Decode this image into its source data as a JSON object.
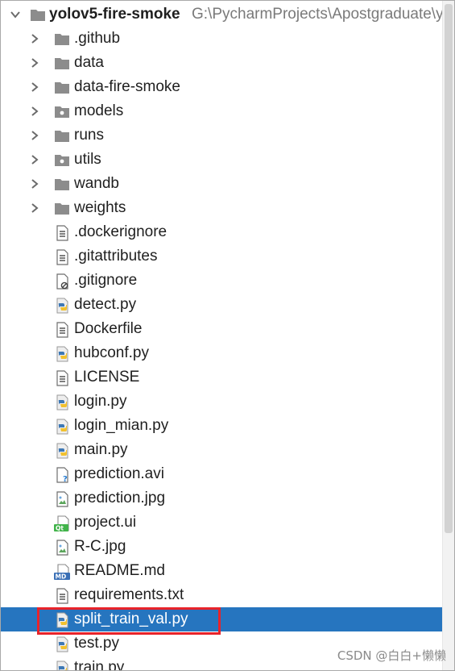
{
  "project": {
    "name": "yolov5-fire-smoke",
    "path": "G:\\PycharmProjects\\Apostgraduate\\yo"
  },
  "items": [
    {
      "label": ".github",
      "kind": "folder",
      "icon": "folder-icon",
      "expandable": true
    },
    {
      "label": "data",
      "kind": "folder",
      "icon": "folder-icon",
      "expandable": true
    },
    {
      "label": "data-fire-smoke",
      "kind": "folder",
      "icon": "folder-icon",
      "expandable": true
    },
    {
      "label": "models",
      "kind": "package",
      "icon": "package-folder-icon",
      "expandable": true
    },
    {
      "label": "runs",
      "kind": "folder",
      "icon": "folder-icon",
      "expandable": true
    },
    {
      "label": "utils",
      "kind": "package",
      "icon": "package-folder-icon",
      "expandable": true
    },
    {
      "label": "wandb",
      "kind": "folder",
      "icon": "folder-icon",
      "expandable": true
    },
    {
      "label": "weights",
      "kind": "folder",
      "icon": "folder-icon",
      "expandable": true
    },
    {
      "label": ".dockerignore",
      "kind": "text",
      "icon": "text-file-icon"
    },
    {
      "label": ".gitattributes",
      "kind": "text",
      "icon": "text-file-icon"
    },
    {
      "label": ".gitignore",
      "kind": "ignore",
      "icon": "ignore-file-icon"
    },
    {
      "label": "detect.py",
      "kind": "python",
      "icon": "python-file-icon"
    },
    {
      "label": "Dockerfile",
      "kind": "text",
      "icon": "text-file-icon"
    },
    {
      "label": "hubconf.py",
      "kind": "python",
      "icon": "python-file-icon"
    },
    {
      "label": "LICENSE",
      "kind": "text",
      "icon": "text-file-icon"
    },
    {
      "label": "login.py",
      "kind": "python",
      "icon": "python-file-icon"
    },
    {
      "label": "login_mian.py",
      "kind": "python",
      "icon": "python-file-icon"
    },
    {
      "label": "main.py",
      "kind": "python",
      "icon": "python-file-icon"
    },
    {
      "label": "prediction.avi",
      "kind": "unknown",
      "icon": "unknown-file-icon"
    },
    {
      "label": "prediction.jpg",
      "kind": "image",
      "icon": "image-file-icon"
    },
    {
      "label": "project.ui",
      "kind": "qt",
      "icon": "qt-ui-file-icon",
      "badge": "Qt"
    },
    {
      "label": "R-C.jpg",
      "kind": "image",
      "icon": "image-file-icon"
    },
    {
      "label": "README.md",
      "kind": "markdown",
      "icon": "markdown-file-icon",
      "badge": "MD"
    },
    {
      "label": "requirements.txt",
      "kind": "text",
      "icon": "text-file-icon"
    },
    {
      "label": "split_train_val.py",
      "kind": "python",
      "icon": "python-file-icon",
      "selected": true
    },
    {
      "label": "test.py",
      "kind": "python",
      "icon": "python-file-icon"
    },
    {
      "label": "train.py",
      "kind": "python",
      "icon": "python-file-icon"
    }
  ],
  "watermark": "CSDN @白白+懒懒",
  "colors": {
    "selection": "#2675bf",
    "highlight_border": "#e8232a",
    "folder": "#8c8c8c",
    "python_blue": "#3d78b5",
    "python_yellow": "#f2c12e"
  }
}
